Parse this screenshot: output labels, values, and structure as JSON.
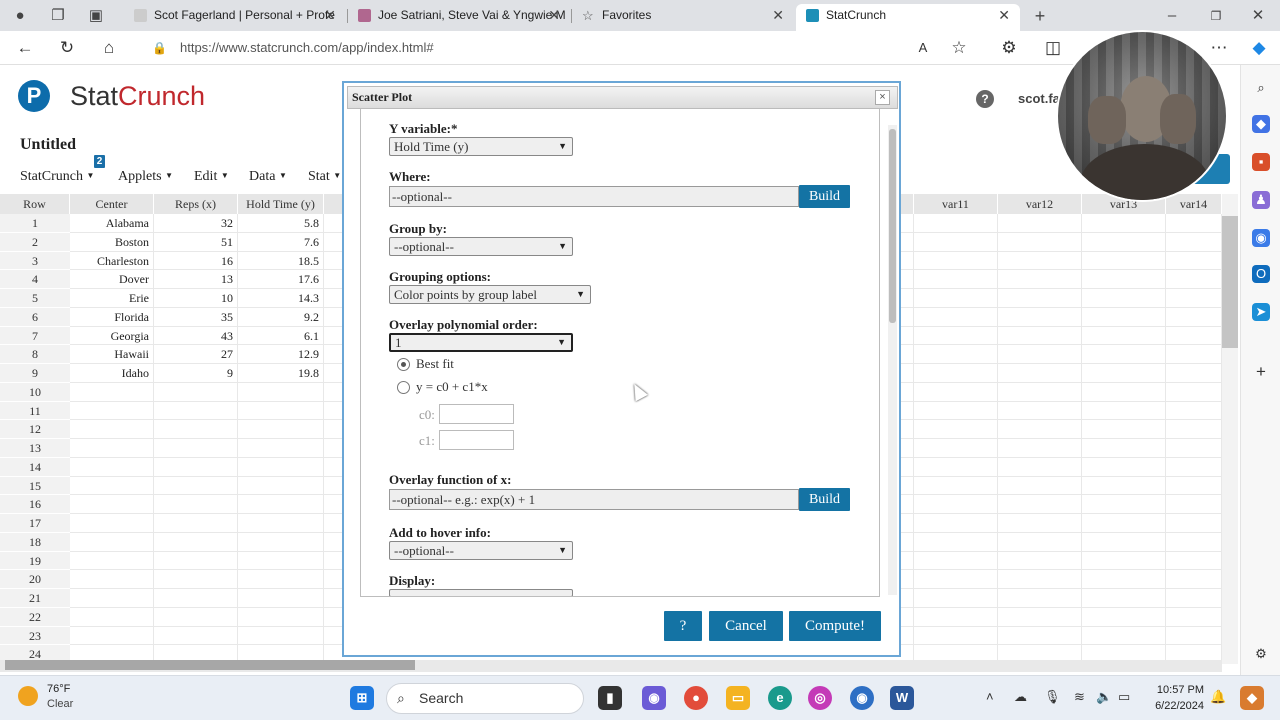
{
  "browser": {
    "tabs": [
      {
        "title": "Scot Fagerland | Personal + Profe",
        "active": false
      },
      {
        "title": "Joe Satriani, Steve Vai & Yngwie M",
        "active": false
      },
      {
        "title": "Favorites",
        "active": false
      },
      {
        "title": "StatCrunch",
        "active": true
      }
    ],
    "url": "https://www.statcrunch.com/app/index.html#"
  },
  "app": {
    "brand_first": "Stat",
    "brand_second": "Crunch",
    "logo_letter": "P",
    "help": "?",
    "user": "scot.fa",
    "doc_title": "Untitled",
    "badge": "2",
    "menus": [
      "StatCrunch",
      "Applets",
      "Edit",
      "Data",
      "Stat"
    ]
  },
  "sheet": {
    "headers": [
      "Row",
      "Center",
      "Reps (x)",
      "Hold Time (y)"
    ],
    "right_headers": [
      "var11",
      "var12",
      "var13",
      "var14"
    ],
    "rows": [
      {
        "row": "1",
        "center": "Alabama",
        "reps": "32",
        "hold": "5.8"
      },
      {
        "row": "2",
        "center": "Boston",
        "reps": "51",
        "hold": "7.6"
      },
      {
        "row": "3",
        "center": "Charleston",
        "reps": "16",
        "hold": "18.5"
      },
      {
        "row": "4",
        "center": "Dover",
        "reps": "13",
        "hold": "17.6"
      },
      {
        "row": "5",
        "center": "Erie",
        "reps": "10",
        "hold": "14.3"
      },
      {
        "row": "6",
        "center": "Florida",
        "reps": "35",
        "hold": "9.2"
      },
      {
        "row": "7",
        "center": "Georgia",
        "reps": "43",
        "hold": "6.1"
      },
      {
        "row": "8",
        "center": "Hawaii",
        "reps": "27",
        "hold": "12.9"
      },
      {
        "row": "9",
        "center": "Idaho",
        "reps": "9",
        "hold": "19.8"
      }
    ],
    "row_numbers": [
      "10",
      "11",
      "12",
      "13",
      "14",
      "15",
      "16",
      "17",
      "18",
      "19",
      "20",
      "21",
      "22",
      "23",
      "24"
    ]
  },
  "dialog": {
    "title": "Scatter Plot",
    "close": "×",
    "y_variable_label": "Y variable:*",
    "y_variable_value": "Hold Time (y)",
    "where_label": "Where:",
    "where_placeholder": "--optional--",
    "build_label": "Build",
    "group_by_label": "Group by:",
    "group_by_value": "--optional--",
    "grouping_options_label": "Grouping options:",
    "grouping_options_value": "Color points by group label",
    "overlay_poly_label": "Overlay polynomial order:",
    "overlay_poly_value": "1",
    "best_fit_label": "Best fit",
    "best_fit_selected": true,
    "equation_label": "y = c0 + c1*x",
    "c0_label": "c0:",
    "c1_label": "c1:",
    "overlay_function_label": "Overlay function of x:",
    "overlay_function_placeholder": "--optional-- e.g.: exp(x) + 1",
    "hover_info_label": "Add to hover info:",
    "hover_info_value": "--optional--",
    "display_label": "Display:",
    "help_button": "?",
    "cancel_button": "Cancel",
    "compute_button": "Compute!"
  },
  "taskbar": {
    "weather_temp": "76°F",
    "weather_cond": "Clear",
    "search_label": "Search",
    "time": "10:57 PM",
    "date": "6/22/2024"
  },
  "colors": {
    "accent": "#1473a4",
    "brand_red": "#c0282d",
    "logo_blue": "#0d6cab"
  }
}
